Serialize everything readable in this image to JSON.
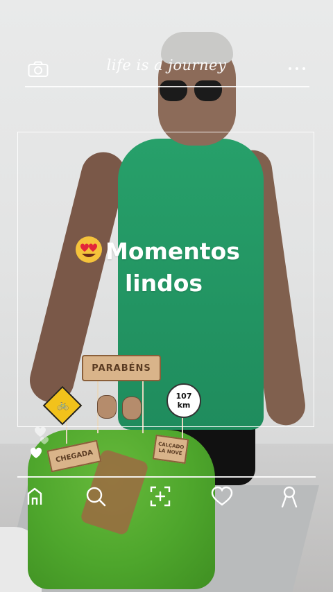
{
  "overlay": {
    "brand_text": "life is a journey",
    "caption_line1": "Momentos",
    "caption_line2": "lindos",
    "caption_emoji": "smiling-face-with-heart-eyes-emoji"
  },
  "nav": {
    "items": [
      "home-icon",
      "search-icon",
      "scan-add-icon",
      "heart-icon",
      "profile-icon"
    ]
  },
  "photo_text": {
    "banner": "PARABÉNS",
    "chegada": "CHEGADA",
    "km_value": "107",
    "km_unit": "km",
    "sign": "CALÇADO LA NOVE"
  },
  "colors": {
    "overlay_white": "#ffffff",
    "shirt_green": "#27a06a",
    "cake_green": "#4ea62c"
  }
}
